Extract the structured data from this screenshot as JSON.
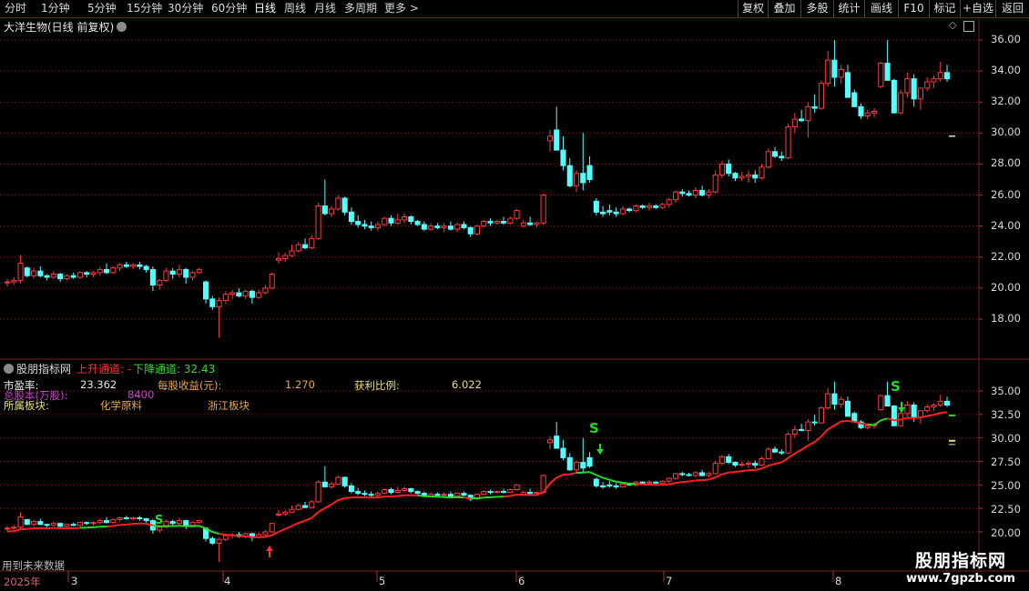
{
  "toolbar": {
    "periods": [
      "分时",
      "1分钟",
      "5分钟",
      "15分钟",
      "30分钟",
      "60分钟",
      "日线",
      "周线",
      "月线",
      "多周期",
      "更多 >"
    ],
    "active_period": "日线",
    "buttons": [
      "复权",
      "叠加",
      "多股",
      "统计",
      "画线",
      "F10",
      "标记",
      "+自选",
      "返回"
    ]
  },
  "main_panel": {
    "title": "大洋生物(日线 前复权)",
    "y_ticks": [
      "36.00",
      "34.00",
      "32.00",
      "30.00",
      "28.00",
      "26.00",
      "24.00",
      "22.00",
      "20.00",
      "18.00"
    ]
  },
  "indicator_panel": {
    "name": "股朋指标网",
    "up_channel_label": "上升通道: -",
    "down_channel_label": "下降通道: 32.43",
    "fields": {
      "pe_label": "市盈率:",
      "pe_value": "23.362",
      "eps_label": "每股收益(元):",
      "eps_value": "1.270",
      "profit_label": "获利比例:",
      "profit_value": "6.022",
      "shares_label": "总股本(万股):",
      "shares_value": "8400",
      "sector_label": "所属板块:",
      "sector_1": "化学原料",
      "sector_2": "浙江板块"
    },
    "y_ticks": [
      "35.00",
      "32.50",
      "30.00",
      "27.50",
      "25.00",
      "22.50",
      "20.00"
    ],
    "signals": [
      "S",
      "S",
      "S"
    ],
    "footer_note": "用到未来数据"
  },
  "x_axis": {
    "labels": [
      "2025年",
      "3",
      "4",
      "5",
      "6",
      "7",
      "8"
    ]
  },
  "watermark": {
    "title": "股朋指标网",
    "url": "www.7gpzb.com"
  },
  "colors": {
    "up": "#ff3b3b",
    "down": "#54ffff",
    "grid": "#7a1f1f",
    "up_channel": "#ff2020",
    "down_channel": "#22dd22",
    "signal": "#22dd22",
    "arrow_up": "#ff3030"
  },
  "candles": [
    [
      20.4,
      20.6,
      20.1,
      20.4
    ],
    [
      20.4,
      20.7,
      20.2,
      20.5
    ],
    [
      20.5,
      22.1,
      20.3,
      21.6
    ],
    [
      21.3,
      21.4,
      20.7,
      20.8
    ],
    [
      20.8,
      21.3,
      20.6,
      21.1
    ],
    [
      21.1,
      21.4,
      20.7,
      20.8
    ],
    [
      20.8,
      20.9,
      20.5,
      20.7
    ],
    [
      20.7,
      21.1,
      20.6,
      20.9
    ],
    [
      20.9,
      21.0,
      20.4,
      20.6
    ],
    [
      20.6,
      20.9,
      20.5,
      20.8
    ],
    [
      20.8,
      21.0,
      20.6,
      20.7
    ],
    [
      20.7,
      21.1,
      20.6,
      21.0
    ],
    [
      21.0,
      21.1,
      20.7,
      20.9
    ],
    [
      20.9,
      21.1,
      20.7,
      21.0
    ],
    [
      21.0,
      21.4,
      20.8,
      21.2
    ],
    [
      21.2,
      21.6,
      20.9,
      21.0
    ],
    [
      21.0,
      21.4,
      20.9,
      21.3
    ],
    [
      21.3,
      21.6,
      21.1,
      21.5
    ],
    [
      21.5,
      21.7,
      21.3,
      21.4
    ],
    [
      21.4,
      21.6,
      21.2,
      21.5
    ],
    [
      21.5,
      21.7,
      21.2,
      21.4
    ],
    [
      21.4,
      21.5,
      21.0,
      21.2
    ],
    [
      21.2,
      21.4,
      19.8,
      20.2
    ],
    [
      20.2,
      20.6,
      19.9,
      20.5
    ],
    [
      20.5,
      21.3,
      20.4,
      21.1
    ],
    [
      21.1,
      21.3,
      20.6,
      20.9
    ],
    [
      20.9,
      21.5,
      20.7,
      21.2
    ],
    [
      21.2,
      21.3,
      20.3,
      20.7
    ],
    [
      20.7,
      21.1,
      20.5,
      21.0
    ],
    [
      21.0,
      21.3,
      20.9,
      21.2
    ],
    [
      20.4,
      20.5,
      19.0,
      19.3
    ],
    [
      19.3,
      19.5,
      18.6,
      18.8
    ],
    [
      18.8,
      19.4,
      16.8,
      19.2
    ],
    [
      19.2,
      19.8,
      19.0,
      19.6
    ],
    [
      19.6,
      19.9,
      19.3,
      19.7
    ],
    [
      19.7,
      20.0,
      19.4,
      19.5
    ],
    [
      19.5,
      19.9,
      19.3,
      19.8
    ],
    [
      19.8,
      19.9,
      19.0,
      19.4
    ],
    [
      19.4,
      19.9,
      19.3,
      19.7
    ],
    [
      19.7,
      20.2,
      19.6,
      20.0
    ],
    [
      20.0,
      21.0,
      19.9,
      20.9
    ],
    [
      21.8,
      22.3,
      21.6,
      21.9
    ],
    [
      21.9,
      22.3,
      21.7,
      22.1
    ],
    [
      22.1,
      22.8,
      22.0,
      22.4
    ],
    [
      22.4,
      23.0,
      22.3,
      22.8
    ],
    [
      22.8,
      23.2,
      22.5,
      22.6
    ],
    [
      22.6,
      23.4,
      22.5,
      23.2
    ],
    [
      23.2,
      25.5,
      23.1,
      25.3
    ],
    [
      25.3,
      27.0,
      24.7,
      24.8
    ],
    [
      24.8,
      25.3,
      24.6,
      25.1
    ],
    [
      25.1,
      26.0,
      25.0,
      25.8
    ],
    [
      25.8,
      25.9,
      24.7,
      24.9
    ],
    [
      24.9,
      25.2,
      24.1,
      24.3
    ],
    [
      24.3,
      24.7,
      23.9,
      24.1
    ],
    [
      24.1,
      24.4,
      23.8,
      24.0
    ],
    [
      24.0,
      24.3,
      23.7,
      23.9
    ],
    [
      23.9,
      24.3,
      23.7,
      24.1
    ],
    [
      24.1,
      24.6,
      24.0,
      24.5
    ],
    [
      24.5,
      24.7,
      24.0,
      24.2
    ],
    [
      24.2,
      24.8,
      24.1,
      24.4
    ],
    [
      24.4,
      24.8,
      24.2,
      24.6
    ],
    [
      24.6,
      24.7,
      24.1,
      24.3
    ],
    [
      24.3,
      24.4,
      24.0,
      24.1
    ],
    [
      24.1,
      24.3,
      23.7,
      23.8
    ],
    [
      23.8,
      24.2,
      23.7,
      24.0
    ],
    [
      24.0,
      24.2,
      23.8,
      23.9
    ],
    [
      23.9,
      24.2,
      23.6,
      24.0
    ],
    [
      24.0,
      24.3,
      23.7,
      23.8
    ],
    [
      23.8,
      24.2,
      23.6,
      24.1
    ],
    [
      24.1,
      24.3,
      23.8,
      23.9
    ],
    [
      23.9,
      24.0,
      23.3,
      23.5
    ],
    [
      23.5,
      24.1,
      23.4,
      24.0
    ],
    [
      24.0,
      24.4,
      23.9,
      24.3
    ],
    [
      24.3,
      24.5,
      24.0,
      24.2
    ],
    [
      24.2,
      24.4,
      24.1,
      24.3
    ],
    [
      24.3,
      24.6,
      24.1,
      24.2
    ],
    [
      24.2,
      24.6,
      24.1,
      24.5
    ],
    [
      24.5,
      25.1,
      24.4,
      25.0
    ],
    [
      24.0,
      24.4,
      23.9,
      24.2
    ],
    [
      24.2,
      24.6,
      24.0,
      24.1
    ],
    [
      24.1,
      24.3,
      23.9,
      24.2
    ],
    [
      24.2,
      26.1,
      24.1,
      26.0
    ],
    [
      29.5,
      30.2,
      28.8,
      29.8
    ],
    [
      30.2,
      31.7,
      28.9,
      28.9
    ],
    [
      28.9,
      29.8,
      27.6,
      27.9
    ],
    [
      27.9,
      28.4,
      26.5,
      26.6
    ],
    [
      26.6,
      27.6,
      26.2,
      27.4
    ],
    [
      27.4,
      30.0,
      26.3,
      26.8
    ],
    [
      27.9,
      28.5,
      26.8,
      27.0
    ],
    [
      25.6,
      25.8,
      24.7,
      24.9
    ],
    [
      24.9,
      25.3,
      24.6,
      24.8
    ],
    [
      25.0,
      25.4,
      24.7,
      24.9
    ],
    [
      24.9,
      25.2,
      24.6,
      24.8
    ],
    [
      24.8,
      25.3,
      24.7,
      25.1
    ],
    [
      25.1,
      25.2,
      24.9,
      25.0
    ],
    [
      25.0,
      25.4,
      24.9,
      25.3
    ],
    [
      25.3,
      25.4,
      25.1,
      25.2
    ],
    [
      25.2,
      25.5,
      25.0,
      25.3
    ],
    [
      25.3,
      25.4,
      25.1,
      25.2
    ],
    [
      25.2,
      25.5,
      25.1,
      25.4
    ],
    [
      25.4,
      25.8,
      25.2,
      25.7
    ],
    [
      25.7,
      26.3,
      25.5,
      26.2
    ],
    [
      26.2,
      26.4,
      25.9,
      26.1
    ],
    [
      26.1,
      26.3,
      25.9,
      26.0
    ],
    [
      26.0,
      26.5,
      25.8,
      26.3
    ],
    [
      26.3,
      26.6,
      25.9,
      26.0
    ],
    [
      26.0,
      26.4,
      25.8,
      26.2
    ],
    [
      26.2,
      27.6,
      26.1,
      27.3
    ],
    [
      27.3,
      28.2,
      27.1,
      28.0
    ],
    [
      28.0,
      28.3,
      27.2,
      27.4
    ],
    [
      27.4,
      27.5,
      26.9,
      27.1
    ],
    [
      27.1,
      27.5,
      26.9,
      27.2
    ],
    [
      27.2,
      27.6,
      26.8,
      27.3
    ],
    [
      27.3,
      27.6,
      26.8,
      27.1
    ],
    [
      27.1,
      28.0,
      27.0,
      27.8
    ],
    [
      27.8,
      29.0,
      27.7,
      28.8
    ],
    [
      28.8,
      29.1,
      28.4,
      28.5
    ],
    [
      28.5,
      28.8,
      28.2,
      28.4
    ],
    [
      28.4,
      30.6,
      28.3,
      30.4
    ],
    [
      30.4,
      31.3,
      30.0,
      30.9
    ],
    [
      30.9,
      31.5,
      30.7,
      30.8
    ],
    [
      30.8,
      32.0,
      29.7,
      31.7
    ],
    [
      31.7,
      32.5,
      31.3,
      31.6
    ],
    [
      31.6,
      33.4,
      31.5,
      33.2
    ],
    [
      33.2,
      35.3,
      33.0,
      34.7
    ],
    [
      34.7,
      36.0,
      33.0,
      33.6
    ],
    [
      33.6,
      34.4,
      33.2,
      34.1
    ],
    [
      33.9,
      34.4,
      32.8,
      32.3
    ],
    [
      32.6,
      32.8,
      31.7,
      31.7
    ],
    [
      31.7,
      31.9,
      30.9,
      31.1
    ],
    [
      31.1,
      31.5,
      30.9,
      31.3
    ],
    [
      31.3,
      31.6,
      31.0,
      31.4
    ],
    [
      33.0,
      34.6,
      32.9,
      34.5
    ],
    [
      34.5,
      36.0,
      33.8,
      33.4
    ],
    [
      33.4,
      33.5,
      31.3,
      31.3
    ],
    [
      31.3,
      32.8,
      31.2,
      32.6
    ],
    [
      32.6,
      33.9,
      32.3,
      33.5
    ],
    [
      33.5,
      33.8,
      31.7,
      32.2
    ],
    [
      32.2,
      32.9,
      31.5,
      32.9
    ],
    [
      32.9,
      33.6,
      32.7,
      33.3
    ],
    [
      33.3,
      33.7,
      32.9,
      33.5
    ],
    [
      33.5,
      34.6,
      33.3,
      33.9
    ],
    [
      33.9,
      34.4,
      33.3,
      33.5
    ]
  ]
}
